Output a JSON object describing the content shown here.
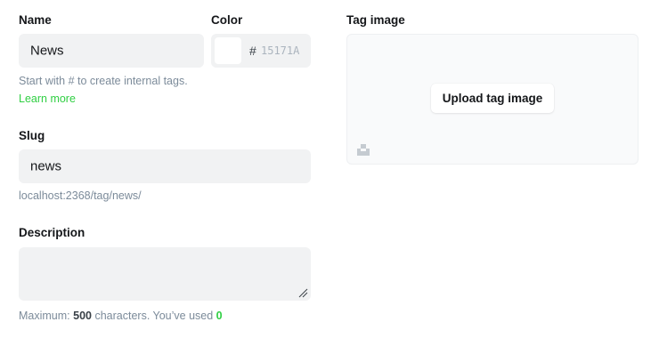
{
  "name": {
    "label": "Name",
    "value": "News",
    "hint": "Start with # to create internal tags.",
    "learn_more": "Learn more"
  },
  "color": {
    "label": "Color",
    "hash": "#",
    "placeholder": "15171A",
    "swatch": "#ffffff"
  },
  "tag_image": {
    "label": "Tag image",
    "upload_label": "Upload tag image",
    "unsplash_icon": "unsplash-icon"
  },
  "slug": {
    "label": "Slug",
    "value": "news",
    "url": "localhost:2368/tag/news/"
  },
  "description": {
    "label": "Description",
    "value": "",
    "count_prefix": "Maximum: ",
    "max": "500",
    "count_middle": " characters. You’ve used ",
    "used": "0"
  },
  "colors": {
    "field_bg": "#f1f2f3",
    "accent": "#30cf43",
    "muted": "#7c8b9a"
  }
}
